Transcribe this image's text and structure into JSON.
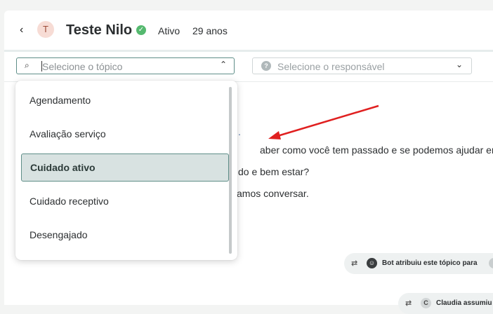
{
  "header": {
    "avatar_letter": "T",
    "name": "Teste Nilo",
    "status": "Ativo",
    "age": "29 anos"
  },
  "filters": {
    "topic_placeholder": "Selecione o tópico",
    "responsible_placeholder": "Selecione o responsável"
  },
  "dropdown": {
    "options": [
      {
        "label": "Agendamento",
        "selected": false
      },
      {
        "label": "Avaliação serviço",
        "selected": false
      },
      {
        "label": "Cuidado ativo",
        "selected": true
      },
      {
        "label": "Cuidado receptivo",
        "selected": false
      },
      {
        "label": "Desengajado",
        "selected": false
      }
    ]
  },
  "conversation": {
    "line1_fragment": ".",
    "line2": "aber como você tem passado e se podemos ajudar em",
    "line3": "do e bem estar?",
    "line4": "amos conversar."
  },
  "events": {
    "bot_text": "Bot atribuiu este tópico para",
    "bot_avatar": "☺",
    "claudia_avatar": "C",
    "claudia_text": "Claudia assumiu"
  },
  "colors": {
    "accent": "#5f8e88",
    "selected_bg": "#d8e2e1",
    "verified": "#55b96f",
    "annotation_arrow": "#e02020"
  },
  "icons": {
    "back": "chevron-left-icon",
    "verified": "check-circle-icon",
    "search": "search-icon",
    "chevron": "chevron-up-icon",
    "help": "question-circle-icon",
    "exchange": "exchange-icon"
  }
}
